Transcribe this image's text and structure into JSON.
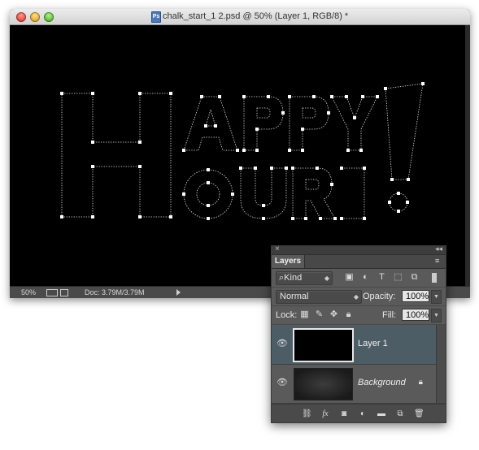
{
  "window": {
    "title": "chalk_start_1 2.psd @ 50% (Layer 1, RGB/8) *"
  },
  "status": {
    "zoom": "50%",
    "doc": "Doc: 3.79M/3.79M"
  },
  "layers_panel": {
    "tab": "Layers",
    "filter_kind": "Kind",
    "blend_mode": "Normal",
    "opacity_label": "Opacity:",
    "opacity_value": "100%",
    "lock_label": "Lock:",
    "fill_label": "Fill:",
    "fill_value": "100%",
    "layers": [
      {
        "name": "Layer 1",
        "selected": true
      },
      {
        "name": "Background",
        "selected": false
      }
    ]
  },
  "canvas": {
    "artwork_text": [
      "HAPPY",
      "HOUR!"
    ],
    "background": "#000000",
    "path_color": "#ffffff"
  },
  "colors": {
    "panel_bg": "#5a5a5a",
    "selection": "#4d5d66"
  }
}
